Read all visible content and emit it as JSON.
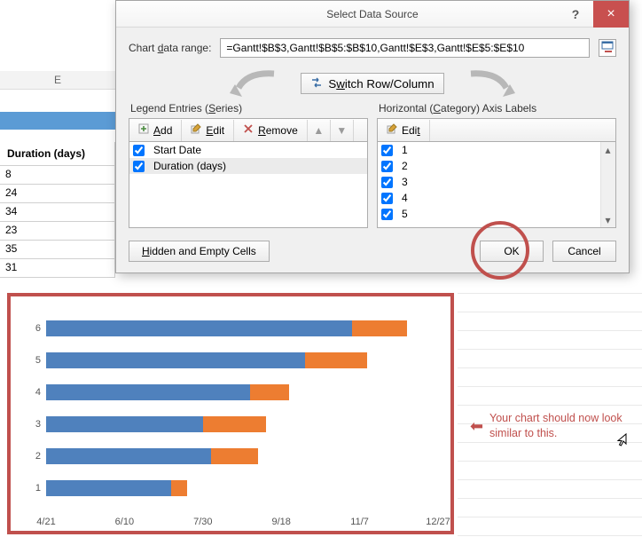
{
  "spreadsheet": {
    "col_header": "E",
    "duration_header": "Duration (days)",
    "cells": [
      "8",
      "24",
      "34",
      "23",
      "35",
      "31"
    ]
  },
  "dialog": {
    "title": "Select Data Source",
    "help": "?",
    "close": "×",
    "range_label": "Chart data range:",
    "range_value": "=Gantt!$B$3,Gantt!$B$5:$B$10,Gantt!$E$3,Gantt!$E$5:$E$10",
    "switch_label": "Switch Row/Column",
    "legend_title": "Legend Entries (Series)",
    "axis_title": "Horizontal (Category) Axis Labels",
    "add": "Add",
    "edit": "Edit",
    "remove": "Remove",
    "series": [
      {
        "label": "Start Date",
        "checked": true,
        "selected": false
      },
      {
        "label": "Duration (days)",
        "checked": true,
        "selected": true
      }
    ],
    "axis_items": [
      "1",
      "2",
      "3",
      "4",
      "5"
    ],
    "hidden": "Hidden and Empty Cells",
    "ok": "OK",
    "cancel": "Cancel",
    "tri_up": "▲",
    "tri_dn": "▼"
  },
  "annotation": {
    "arrow": "⬅",
    "text": "Your chart should now look similar to this."
  },
  "chart_data": {
    "type": "bar",
    "orientation": "horizontal",
    "stacked": true,
    "title": "",
    "xlabel": "",
    "ylabel": "",
    "y_categories": [
      "1",
      "2",
      "3",
      "4",
      "5",
      "6"
    ],
    "x_ticks": [
      "4/21",
      "6/10",
      "7/30",
      "9/18",
      "11/7",
      "12/27"
    ],
    "x_range_days": [
      0,
      250
    ],
    "series": [
      {
        "name": "Start Date",
        "color": "#4f81bd",
        "values": [
          80,
          105,
          100,
          130,
          165,
          195
        ]
      },
      {
        "name": "Duration (days)",
        "color": "#ed7d31",
        "values": [
          10,
          30,
          40,
          25,
          40,
          35
        ]
      }
    ]
  }
}
